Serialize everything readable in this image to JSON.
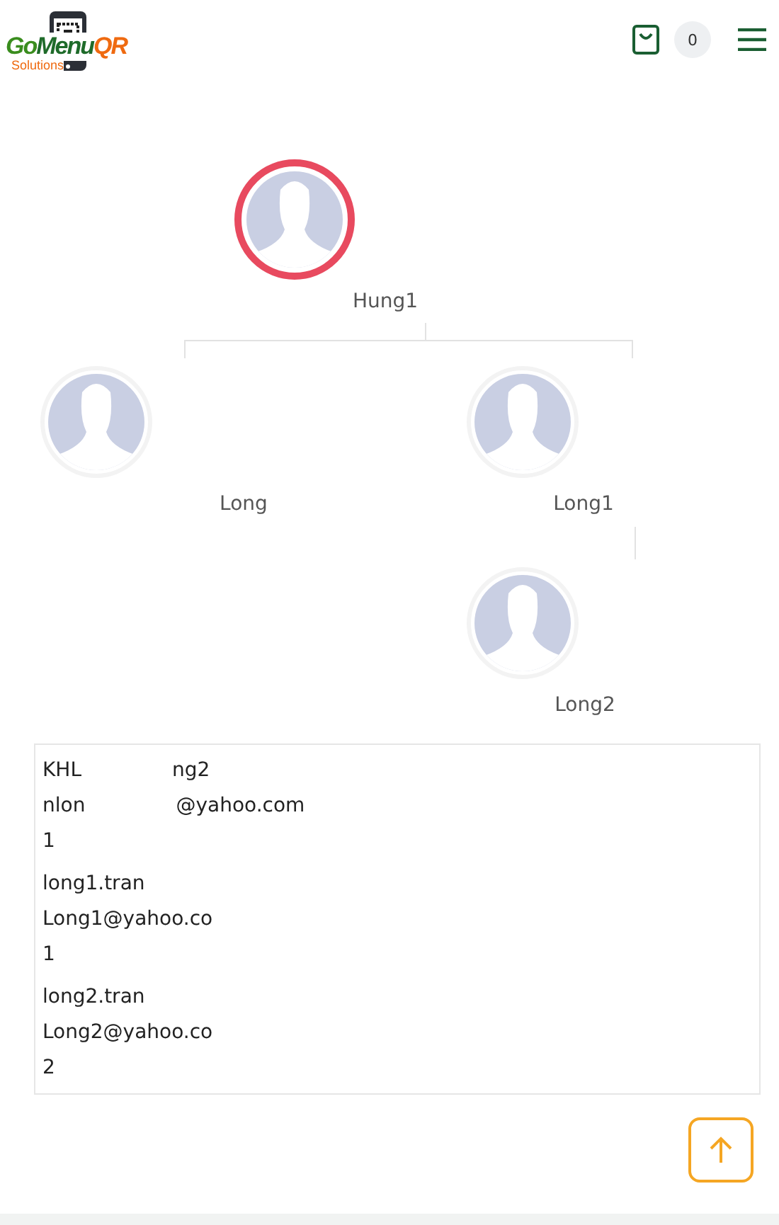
{
  "header": {
    "logo": {
      "parts": [
        "Go",
        "Menu",
        "QR"
      ],
      "tagline": "Solutions"
    },
    "cart_count": "0"
  },
  "tree": {
    "name": "Hung1",
    "highlighted": true,
    "children": [
      {
        "name": "Long",
        "highlighted": false
      },
      {
        "name": "Long1",
        "highlighted": false,
        "children": [
          {
            "name": "Long2",
            "highlighted": false
          }
        ]
      }
    ]
  },
  "details": [
    {
      "lines": [
        [
          "KHL",
          "ng2"
        ],
        [
          "nlon",
          "@yahoo.com"
        ],
        [
          "1"
        ]
      ]
    },
    {
      "lines": [
        [
          "long1.tran"
        ],
        [
          "Long1@yahoo.co"
        ],
        [
          "1"
        ]
      ]
    },
    {
      "lines": [
        [
          "long2.tran"
        ],
        [
          "Long2@yahoo.co"
        ],
        [
          "2"
        ]
      ]
    }
  ]
}
